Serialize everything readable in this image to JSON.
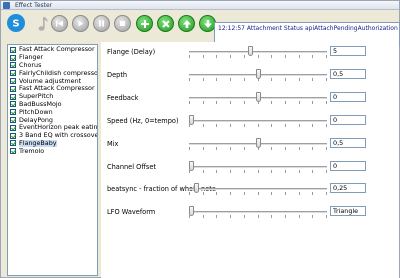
{
  "window": {
    "title": "Effect Tester"
  },
  "status_text": "12:12:57 Attachment Status apiAttachPendingAuthorization",
  "effects": [
    {
      "label": "Fast Attack Compressor 117",
      "checked": true,
      "selected": false
    },
    {
      "label": "Flanger",
      "checked": true,
      "selected": false
    },
    {
      "label": "Chorus",
      "checked": true,
      "selected": false
    },
    {
      "label": "FairlyChildish compressor/limi",
      "checked": true,
      "selected": false
    },
    {
      "label": "Volume adjustment",
      "checked": true,
      "selected": false
    },
    {
      "label": "Fast Attack Compressor 117",
      "checked": true,
      "selected": false
    },
    {
      "label": "SuperPitch",
      "checked": true,
      "selected": false
    },
    {
      "label": "BadBussMojo",
      "checked": true,
      "selected": false
    },
    {
      "label": "PitchDown",
      "checked": true,
      "selected": false
    },
    {
      "label": "DelayPong",
      "checked": true,
      "selected": false
    },
    {
      "label": "EventHorizon peak eating lin",
      "checked": true,
      "selected": false
    },
    {
      "label": "3 Band EQ with crossover",
      "checked": true,
      "selected": false
    },
    {
      "label": "FlangeBaby",
      "checked": true,
      "selected": true
    },
    {
      "label": "Tremolo",
      "checked": true,
      "selected": false
    }
  ],
  "parameters": [
    {
      "label": "Flange (Delay)",
      "value": "5",
      "level": 0.44
    },
    {
      "label": "Depth",
      "value": "0,5",
      "level": 0.5
    },
    {
      "label": "Feedback",
      "value": "0",
      "level": 0.5
    },
    {
      "label": "Speed (Hz, 0=tempo)",
      "value": "0",
      "level": 0.0
    },
    {
      "label": "Mix",
      "value": "0,5",
      "level": 0.5
    },
    {
      "label": "Channel Offset",
      "value": "0",
      "level": 0.0
    },
    {
      "label": "beatsync - fraction of whole note",
      "value": "0,25",
      "level": 0.04
    },
    {
      "label": "LFO Waveform",
      "value": "Triangle",
      "level": 0.0
    }
  ]
}
